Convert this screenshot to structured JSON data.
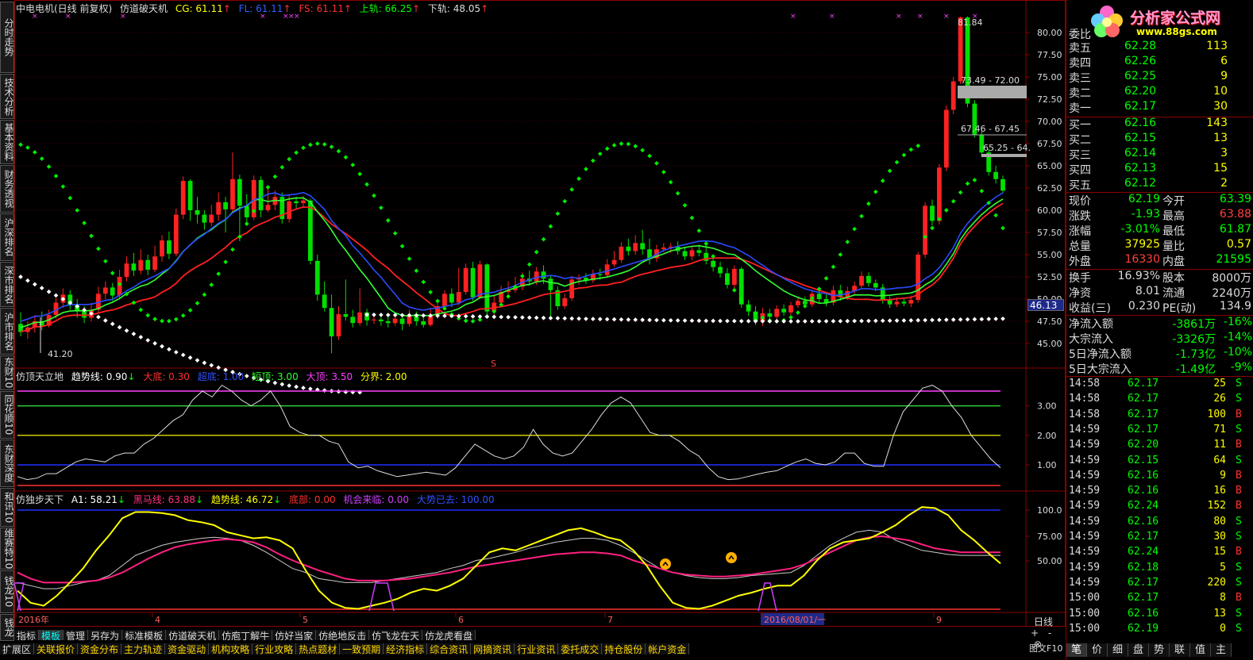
{
  "header": {
    "stock": "中电电机(日线 前复权)",
    "indicator": "仿道破天机",
    "cg": "CG: 61.11",
    "fl": "FL: 61.11",
    "fs": "FS: 61.11",
    "upper": "上轨: 66.25",
    "lower": "下轨: 48.05",
    "arrow": "↑"
  },
  "left_tabs": [
    "分时走势",
    "技术分析",
    "基本资料",
    "财务透视",
    "沪深排名",
    "深市排名",
    "沪市排名",
    "东财10",
    "同花顺10",
    "东财深度",
    "和讯10",
    "维赛特10",
    "钱龙10",
    "钱龙"
  ],
  "main_chart": {
    "y_ticks": [
      "80.00",
      "77.50",
      "75.00",
      "72.50",
      "70.00",
      "67.50",
      "65.00",
      "62.50",
      "60.00",
      "57.50",
      "55.00",
      "52.50",
      "50.00",
      "47.50",
      "45.00"
    ],
    "annot_high": "81.84",
    "annot_low": "41.20",
    "annot_r1": "73.49 - 72.00",
    "annot_r2": "67.46 - 67.45",
    "annot_r3": "65.25 - 64.",
    "cursor_price": "46.13",
    "s_marker": "S",
    "colors": {
      "up": "#ff2222",
      "down": "#00e000",
      "ma_red": "#ff2020",
      "ma_blue": "#2a4cff",
      "ma_green": "#33ff33",
      "dot_green": "#00ee00",
      "dot_white": "#ffffff"
    }
  },
  "panel1": {
    "name": "仿顶天立地",
    "trend": "趋势线: 0.90",
    "trend_arrow": "↓",
    "dadi": "大底: 0.30",
    "chaodi": "超底: 1.00",
    "duanding": "短顶: 3.00",
    "dading": "大顶: 3.50",
    "fenjie": "分界: 2.00",
    "y_ticks": [
      "3.00",
      "2.00",
      "1.00"
    ]
  },
  "panel2": {
    "name": "仿独步天下",
    "a1": "A1: 58.21",
    "a1_arrow": "↓",
    "heima": "黑马线: 63.88",
    "heima_arrow": "↓",
    "qushi": "趋势线: 46.72",
    "qushi_arrow": "↓",
    "dibu": "底部: 0.00",
    "jihui": "机会来临: 0.00",
    "dashi": "大势已去: 100.00",
    "y_ticks": [
      "100.0",
      "75.00",
      "50.00"
    ]
  },
  "dates": [
    "2016年",
    "4",
    "5",
    "6",
    "7",
    "2016/08/01/一",
    "9"
  ],
  "period": "日线",
  "bottom_tabs": [
    "指标",
    "模板",
    "管理",
    "另存为",
    "标准模板",
    "仿道破天机",
    "仿庖丁解牛",
    "仿好当家",
    "仿绝地反击",
    "仿飞龙在天",
    "仿龙虎看盘"
  ],
  "bottom_tabs2": [
    "扩展区",
    "关联报价",
    "资金分布",
    "主力轨迹",
    "资金驱动",
    "机构攻略",
    "行业攻略",
    "热点题材",
    "一致预期",
    "经济指标",
    "综合资讯",
    "网摘资讯",
    "行业资讯",
    "委托成交",
    "持仓股份",
    "帐户资金"
  ],
  "logo": {
    "name": "分析家公式网",
    "url": "www.88gs.com"
  },
  "order_book": {
    "title": "委比",
    "asks": [
      {
        "label": "卖五",
        "price": "62.28",
        "vol": "113"
      },
      {
        "label": "卖四",
        "price": "62.26",
        "vol": "6"
      },
      {
        "label": "卖三",
        "price": "62.25",
        "vol": "9"
      },
      {
        "label": "卖二",
        "price": "62.20",
        "vol": "10"
      },
      {
        "label": "卖一",
        "price": "62.17",
        "vol": "30"
      }
    ],
    "bids": [
      {
        "label": "买一",
        "price": "62.16",
        "vol": "143"
      },
      {
        "label": "买二",
        "price": "62.15",
        "vol": "13"
      },
      {
        "label": "买三",
        "price": "62.14",
        "vol": "3"
      },
      {
        "label": "买四",
        "price": "62.13",
        "vol": "15"
      },
      {
        "label": "买五",
        "price": "62.12",
        "vol": "2"
      }
    ]
  },
  "quote": [
    {
      "l1": "现价",
      "v1": "62.19",
      "c1": "#00ff00",
      "l2": "今开",
      "v2": "63.39",
      "c2": "#00ff00"
    },
    {
      "l1": "涨跌",
      "v1": "-1.93",
      "c1": "#00ff00",
      "l2": "最高",
      "v2": "63.88",
      "c2": "#ff4040"
    },
    {
      "l1": "涨幅",
      "v1": "-3.01%",
      "c1": "#00ff00",
      "l2": "最低",
      "v2": "61.87",
      "c2": "#00ff00"
    },
    {
      "l1": "总量",
      "v1": "37925",
      "c1": "#ffff00",
      "l2": "量比",
      "v2": "0.57",
      "c2": "#ffff00"
    },
    {
      "l1": "外盘",
      "v1": "16330",
      "c1": "#ff4040",
      "l2": "内盘",
      "v2": "21595",
      "c2": "#00ff00"
    }
  ],
  "quote2": [
    {
      "l1": "换手",
      "v1": "16.93%",
      "l2": "股本",
      "v2": "8000万"
    },
    {
      "l1": "净资",
      "v1": "8.01",
      "l2": "流通",
      "v2": "2240万"
    },
    {
      "l1": "收益(三)",
      "v1": "0.230",
      "l2": "PE(动)",
      "v2": "134.9"
    }
  ],
  "flows": [
    {
      "l": "净流入额",
      "v": "-3861万",
      "p": "-16%"
    },
    {
      "l": "大宗流入",
      "v": "-3326万",
      "p": "-14%"
    },
    {
      "l": "5日净流入额",
      "v": "-1.73亿",
      "p": "-10%"
    },
    {
      "l": "5日大宗流入",
      "v": "-1.49亿",
      "p": "-9%"
    }
  ],
  "ticks": [
    {
      "t": "14:58",
      "p": "62.17",
      "v": "25",
      "s": "S",
      "pc": "#00ff00",
      "sc": "#00ff00"
    },
    {
      "t": "14:58",
      "p": "62.17",
      "v": "26",
      "s": "S",
      "pc": "#00ff00",
      "sc": "#00ff00"
    },
    {
      "t": "14:58",
      "p": "62.17",
      "v": "100",
      "s": "B",
      "pc": "#00ff00",
      "sc": "#ff3030"
    },
    {
      "t": "14:59",
      "p": "62.17",
      "v": "71",
      "s": "S",
      "pc": "#00ff00",
      "sc": "#00ff00"
    },
    {
      "t": "14:59",
      "p": "62.20",
      "v": "11",
      "s": "B",
      "pc": "#00ff00",
      "sc": "#ff3030"
    },
    {
      "t": "14:59",
      "p": "62.15",
      "v": "64",
      "s": "S",
      "pc": "#00ff00",
      "sc": "#00ff00"
    },
    {
      "t": "14:59",
      "p": "62.16",
      "v": "9",
      "s": "B",
      "pc": "#00ff00",
      "sc": "#ff3030"
    },
    {
      "t": "14:59",
      "p": "62.16",
      "v": "16",
      "s": "B",
      "pc": "#00ff00",
      "sc": "#ff3030"
    },
    {
      "t": "14:59",
      "p": "62.24",
      "v": "152",
      "s": "B",
      "pc": "#00ff00",
      "sc": "#ff3030"
    },
    {
      "t": "14:59",
      "p": "62.16",
      "v": "80",
      "s": "S",
      "pc": "#00ff00",
      "sc": "#00ff00"
    },
    {
      "t": "14:59",
      "p": "62.17",
      "v": "30",
      "s": "S",
      "pc": "#00ff00",
      "sc": "#00ff00"
    },
    {
      "t": "14:59",
      "p": "62.24",
      "v": "15",
      "s": "B",
      "pc": "#00ff00",
      "sc": "#ff3030"
    },
    {
      "t": "14:59",
      "p": "62.18",
      "v": "5",
      "s": "S",
      "pc": "#00ff00",
      "sc": "#00ff00"
    },
    {
      "t": "14:59",
      "p": "62.17",
      "v": "220",
      "s": "S",
      "pc": "#00ff00",
      "sc": "#00ff00"
    },
    {
      "t": "15:00",
      "p": "62.17",
      "v": "8",
      "s": "B",
      "pc": "#00ff00",
      "sc": "#ff3030"
    },
    {
      "t": "15:00",
      "p": "62.16",
      "v": "13",
      "s": "S",
      "pc": "#00ff00",
      "sc": "#00ff00"
    },
    {
      "t": "15:00",
      "p": "62.19",
      "v": "0",
      "s": "S",
      "pc": "#00ff00",
      "sc": "#00ff00"
    }
  ],
  "right_tabs": [
    "笔",
    "价",
    "细",
    "盘",
    "势",
    "联",
    "值",
    "主"
  ],
  "status": {
    "tuwen": "图文F10",
    "plus": "+",
    "minus": "-",
    "close": "⊗"
  }
}
